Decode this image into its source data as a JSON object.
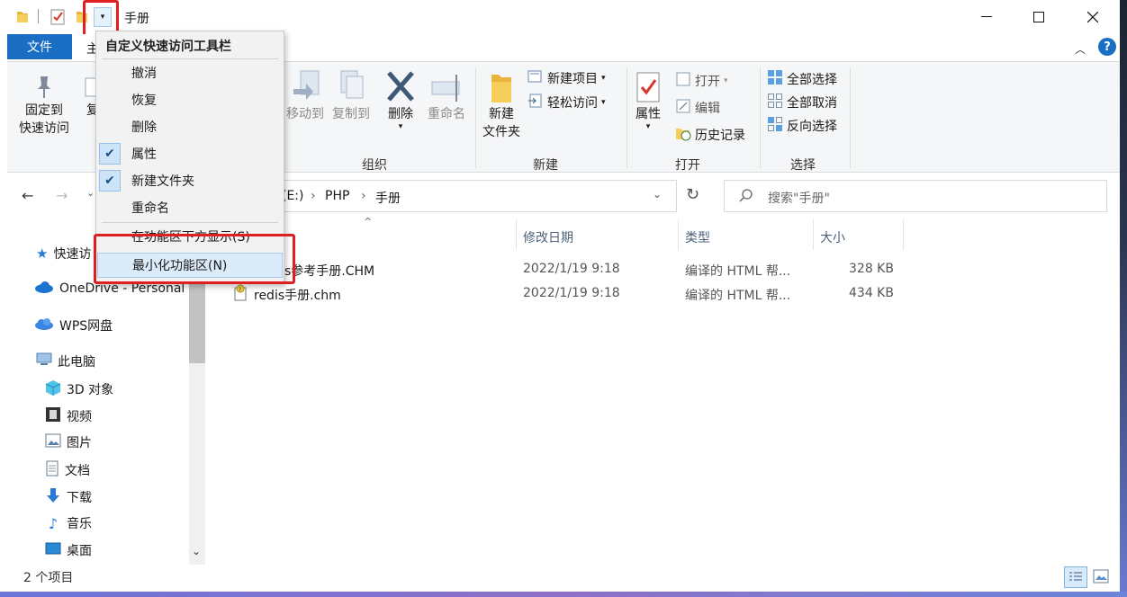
{
  "window": {
    "title": "手册"
  },
  "ribbon_tabs": {
    "file": "文件",
    "home_partial": "主"
  },
  "ribbon": {
    "pin_line1": "固定到",
    "pin_line2": "快速访问",
    "copy_partial": "复",
    "move_to": "移动到",
    "copy_to": "复制到",
    "delete": "删除",
    "rename": "重命名",
    "new_folder_line1": "新建",
    "new_folder_line2": "文件夹",
    "new_item": "新建项目",
    "easy_access": "轻松访问",
    "properties": "属性",
    "open": "打开",
    "edit": "编辑",
    "history": "历史记录",
    "select_all": "全部选择",
    "select_none": "全部取消",
    "invert_selection": "反向选择",
    "groups": {
      "organize": "组织",
      "new": "新建",
      "open": "打开",
      "select": "选择"
    }
  },
  "address": {
    "drive_partial": "(E:)",
    "sep": "›",
    "segments": [
      "PHP",
      "手册"
    ],
    "search_placeholder": "搜索\"手册\""
  },
  "sidebar": {
    "quick_access_partial": "快速访",
    "onedrive": "OneDrive - Personal",
    "wps": "WPS网盘",
    "this_pc": "此电脑",
    "items": [
      "3D 对象",
      "视频",
      "图片",
      "文档",
      "下载",
      "音乐",
      "桌面"
    ]
  },
  "columns": {
    "date": "修改日期",
    "type": "类型",
    "size": "大小"
  },
  "files": [
    {
      "name_partial": "s参考手册.CHM",
      "date": "2022/1/19 9:18",
      "type": "编译的 HTML 帮...",
      "size": "328 KB"
    },
    {
      "name": "redis手册.chm",
      "date": "2022/1/19 9:18",
      "type": "编译的 HTML 帮...",
      "size": "434 KB"
    }
  ],
  "status": {
    "count": "2 个项目"
  },
  "menu": {
    "title": "自定义快速访问工具栏",
    "items": [
      "撤消",
      "恢复",
      "删除",
      "属性",
      "新建文件夹",
      "重命名"
    ],
    "show_below": "在功能区下方显示(S)",
    "minimize": "最小化功能区(N)"
  },
  "colors": {
    "accent": "#1a6fc4",
    "highlight_box": "#e02020"
  }
}
